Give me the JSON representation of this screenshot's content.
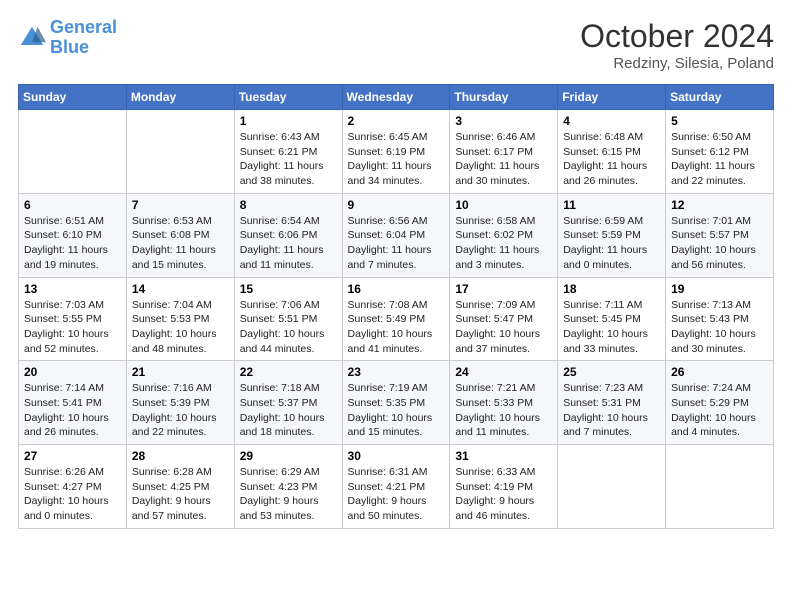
{
  "logo": {
    "text_general": "General",
    "text_blue": "Blue"
  },
  "title": "October 2024",
  "subtitle": "Redziny, Silesia, Poland",
  "days_of_week": [
    "Sunday",
    "Monday",
    "Tuesday",
    "Wednesday",
    "Thursday",
    "Friday",
    "Saturday"
  ],
  "weeks": [
    [
      {
        "day": "",
        "sunrise": "",
        "sunset": "",
        "daylight": ""
      },
      {
        "day": "",
        "sunrise": "",
        "sunset": "",
        "daylight": ""
      },
      {
        "day": "1",
        "sunrise": "Sunrise: 6:43 AM",
        "sunset": "Sunset: 6:21 PM",
        "daylight": "Daylight: 11 hours and 38 minutes."
      },
      {
        "day": "2",
        "sunrise": "Sunrise: 6:45 AM",
        "sunset": "Sunset: 6:19 PM",
        "daylight": "Daylight: 11 hours and 34 minutes."
      },
      {
        "day": "3",
        "sunrise": "Sunrise: 6:46 AM",
        "sunset": "Sunset: 6:17 PM",
        "daylight": "Daylight: 11 hours and 30 minutes."
      },
      {
        "day": "4",
        "sunrise": "Sunrise: 6:48 AM",
        "sunset": "Sunset: 6:15 PM",
        "daylight": "Daylight: 11 hours and 26 minutes."
      },
      {
        "day": "5",
        "sunrise": "Sunrise: 6:50 AM",
        "sunset": "Sunset: 6:12 PM",
        "daylight": "Daylight: 11 hours and 22 minutes."
      }
    ],
    [
      {
        "day": "6",
        "sunrise": "Sunrise: 6:51 AM",
        "sunset": "Sunset: 6:10 PM",
        "daylight": "Daylight: 11 hours and 19 minutes."
      },
      {
        "day": "7",
        "sunrise": "Sunrise: 6:53 AM",
        "sunset": "Sunset: 6:08 PM",
        "daylight": "Daylight: 11 hours and 15 minutes."
      },
      {
        "day": "8",
        "sunrise": "Sunrise: 6:54 AM",
        "sunset": "Sunset: 6:06 PM",
        "daylight": "Daylight: 11 hours and 11 minutes."
      },
      {
        "day": "9",
        "sunrise": "Sunrise: 6:56 AM",
        "sunset": "Sunset: 6:04 PM",
        "daylight": "Daylight: 11 hours and 7 minutes."
      },
      {
        "day": "10",
        "sunrise": "Sunrise: 6:58 AM",
        "sunset": "Sunset: 6:02 PM",
        "daylight": "Daylight: 11 hours and 3 minutes."
      },
      {
        "day": "11",
        "sunrise": "Sunrise: 6:59 AM",
        "sunset": "Sunset: 5:59 PM",
        "daylight": "Daylight: 11 hours and 0 minutes."
      },
      {
        "day": "12",
        "sunrise": "Sunrise: 7:01 AM",
        "sunset": "Sunset: 5:57 PM",
        "daylight": "Daylight: 10 hours and 56 minutes."
      }
    ],
    [
      {
        "day": "13",
        "sunrise": "Sunrise: 7:03 AM",
        "sunset": "Sunset: 5:55 PM",
        "daylight": "Daylight: 10 hours and 52 minutes."
      },
      {
        "day": "14",
        "sunrise": "Sunrise: 7:04 AM",
        "sunset": "Sunset: 5:53 PM",
        "daylight": "Daylight: 10 hours and 48 minutes."
      },
      {
        "day": "15",
        "sunrise": "Sunrise: 7:06 AM",
        "sunset": "Sunset: 5:51 PM",
        "daylight": "Daylight: 10 hours and 44 minutes."
      },
      {
        "day": "16",
        "sunrise": "Sunrise: 7:08 AM",
        "sunset": "Sunset: 5:49 PM",
        "daylight": "Daylight: 10 hours and 41 minutes."
      },
      {
        "day": "17",
        "sunrise": "Sunrise: 7:09 AM",
        "sunset": "Sunset: 5:47 PM",
        "daylight": "Daylight: 10 hours and 37 minutes."
      },
      {
        "day": "18",
        "sunrise": "Sunrise: 7:11 AM",
        "sunset": "Sunset: 5:45 PM",
        "daylight": "Daylight: 10 hours and 33 minutes."
      },
      {
        "day": "19",
        "sunrise": "Sunrise: 7:13 AM",
        "sunset": "Sunset: 5:43 PM",
        "daylight": "Daylight: 10 hours and 30 minutes."
      }
    ],
    [
      {
        "day": "20",
        "sunrise": "Sunrise: 7:14 AM",
        "sunset": "Sunset: 5:41 PM",
        "daylight": "Daylight: 10 hours and 26 minutes."
      },
      {
        "day": "21",
        "sunrise": "Sunrise: 7:16 AM",
        "sunset": "Sunset: 5:39 PM",
        "daylight": "Daylight: 10 hours and 22 minutes."
      },
      {
        "day": "22",
        "sunrise": "Sunrise: 7:18 AM",
        "sunset": "Sunset: 5:37 PM",
        "daylight": "Daylight: 10 hours and 18 minutes."
      },
      {
        "day": "23",
        "sunrise": "Sunrise: 7:19 AM",
        "sunset": "Sunset: 5:35 PM",
        "daylight": "Daylight: 10 hours and 15 minutes."
      },
      {
        "day": "24",
        "sunrise": "Sunrise: 7:21 AM",
        "sunset": "Sunset: 5:33 PM",
        "daylight": "Daylight: 10 hours and 11 minutes."
      },
      {
        "day": "25",
        "sunrise": "Sunrise: 7:23 AM",
        "sunset": "Sunset: 5:31 PM",
        "daylight": "Daylight: 10 hours and 7 minutes."
      },
      {
        "day": "26",
        "sunrise": "Sunrise: 7:24 AM",
        "sunset": "Sunset: 5:29 PM",
        "daylight": "Daylight: 10 hours and 4 minutes."
      }
    ],
    [
      {
        "day": "27",
        "sunrise": "Sunrise: 6:26 AM",
        "sunset": "Sunset: 4:27 PM",
        "daylight": "Daylight: 10 hours and 0 minutes."
      },
      {
        "day": "28",
        "sunrise": "Sunrise: 6:28 AM",
        "sunset": "Sunset: 4:25 PM",
        "daylight": "Daylight: 9 hours and 57 minutes."
      },
      {
        "day": "29",
        "sunrise": "Sunrise: 6:29 AM",
        "sunset": "Sunset: 4:23 PM",
        "daylight": "Daylight: 9 hours and 53 minutes."
      },
      {
        "day": "30",
        "sunrise": "Sunrise: 6:31 AM",
        "sunset": "Sunset: 4:21 PM",
        "daylight": "Daylight: 9 hours and 50 minutes."
      },
      {
        "day": "31",
        "sunrise": "Sunrise: 6:33 AM",
        "sunset": "Sunset: 4:19 PM",
        "daylight": "Daylight: 9 hours and 46 minutes."
      },
      {
        "day": "",
        "sunrise": "",
        "sunset": "",
        "daylight": ""
      },
      {
        "day": "",
        "sunrise": "",
        "sunset": "",
        "daylight": ""
      }
    ]
  ]
}
